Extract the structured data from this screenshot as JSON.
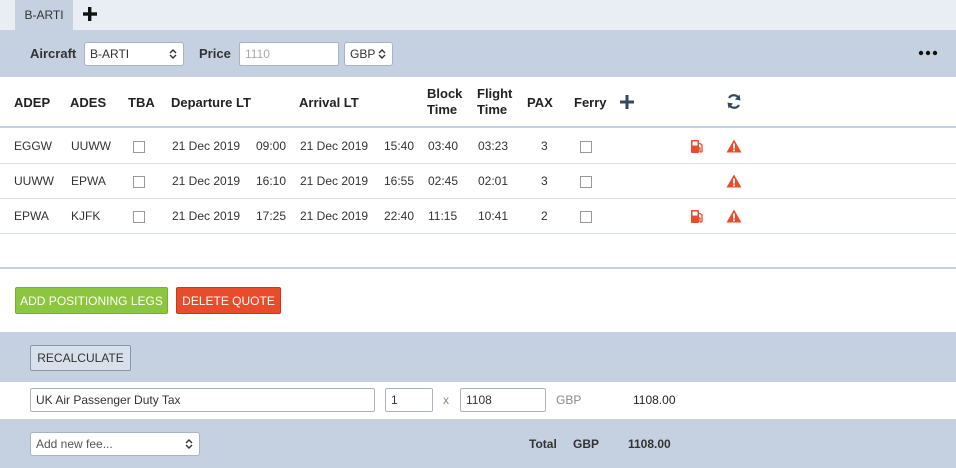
{
  "tabs": [
    {
      "label": "B-ARTI",
      "active": true
    }
  ],
  "toolbar": {
    "aircraft_label": "Aircraft",
    "aircraft_value": "B-ARTI",
    "price_label": "Price",
    "price_placeholder": "1110",
    "currency_value": "GBP"
  },
  "table": {
    "headers": {
      "adep": "ADEP",
      "ades": "ADES",
      "tba": "TBA",
      "departure": "Departure LT",
      "arrival": "Arrival LT",
      "block_1": "Block",
      "block_2": "Time",
      "flight_1": "Flight",
      "flight_2": "Time",
      "pax": "PAX",
      "ferry": "Ferry"
    },
    "rows": [
      {
        "adep": "EGGW",
        "ades": "UUWW",
        "tba": false,
        "dep_date": "21 Dec 2019",
        "dep_time": "09:00",
        "arr_date": "21 Dec 2019",
        "arr_time": "15:40",
        "block": "03:40",
        "flight": "03:23",
        "pax": "3",
        "ferry": false,
        "fuel_icon": true,
        "warning_icon": true
      },
      {
        "adep": "UUWW",
        "ades": "EPWA",
        "tba": false,
        "dep_date": "21 Dec 2019",
        "dep_time": "16:10",
        "arr_date": "21 Dec 2019",
        "arr_time": "16:55",
        "block": "02:45",
        "flight": "02:01",
        "pax": "3",
        "ferry": false,
        "fuel_icon": false,
        "warning_icon": true
      },
      {
        "adep": "EPWA",
        "ades": "KJFK",
        "tba": false,
        "dep_date": "21 Dec 2019",
        "dep_time": "17:25",
        "arr_date": "21 Dec 2019",
        "arr_time": "22:40",
        "block": "11:15",
        "flight": "10:41",
        "pax": "2",
        "ferry": false,
        "fuel_icon": true,
        "warning_icon": true
      }
    ]
  },
  "actions": {
    "add_positioning": "ADD POSITIONING LEGS",
    "delete_quote": "DELETE QUOTE",
    "recalculate": "RECALCULATE"
  },
  "fees": [
    {
      "name": "UK Air Passenger Duty Tax",
      "quantity": "1",
      "multiplier": "x",
      "unit_price": "1108",
      "currency": "GBP",
      "amount": "1108.00"
    }
  ],
  "footer": {
    "new_fee_placeholder": "Add new fee...",
    "total_label": "Total",
    "total_currency": "GBP",
    "total_value": "1108.00"
  },
  "colors": {
    "accent_band": "#c5d1e1",
    "green_button": "#8cc63f",
    "red_button": "#e84c2b",
    "icon_red": "#e84c2b",
    "icon_navy": "#34495e"
  }
}
